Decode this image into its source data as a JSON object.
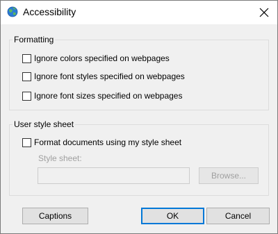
{
  "window": {
    "title": "Accessibility",
    "icon": "globe-icon",
    "close": "close-icon"
  },
  "formatting": {
    "label": "Formatting",
    "options": [
      {
        "label": "Ignore colors specified on webpages",
        "checked": false
      },
      {
        "label": "Ignore font styles specified on webpages",
        "checked": false
      },
      {
        "label": "Ignore font sizes specified on webpages",
        "checked": false
      }
    ]
  },
  "user_style_sheet": {
    "label": "User style sheet",
    "format_option": {
      "label": "Format documents using my style sheet",
      "checked": false
    },
    "style_sheet_label": "Style sheet:",
    "style_sheet_value": "",
    "browse_label": "Browse..."
  },
  "buttons": {
    "captions": "Captions",
    "ok": "OK",
    "cancel": "Cancel"
  },
  "colors": {
    "accent": "#0078d7",
    "disabled_text": "#a0a0a0"
  }
}
